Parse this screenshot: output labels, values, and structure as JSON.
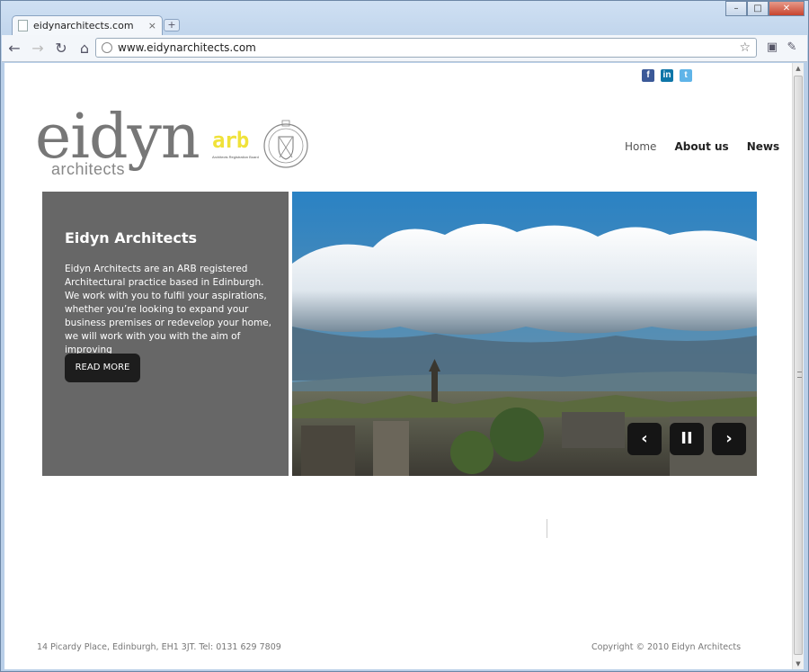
{
  "browser": {
    "tab_title": "eidynarchitects.com",
    "tab_close": "×",
    "new_tab": "+",
    "url": "www.eidynarchitects.com",
    "back_icon": "←",
    "forward_icon": "→",
    "reload_icon": "↻",
    "home_icon": "⌂",
    "star_icon": "☆",
    "page_icon": "▣",
    "wrench_icon": "✎",
    "minimize": "–",
    "maximize": "□",
    "close": "✕"
  },
  "social": {
    "facebook": "f",
    "linkedin": "in",
    "twitter": "t"
  },
  "logo": {
    "word": "eidyn",
    "sub": "architects",
    "arb_mark": "arb",
    "arb_text": "Architects Registration Board"
  },
  "nav": {
    "items": [
      "Home",
      "About us",
      "News"
    ]
  },
  "hero": {
    "title": "Eidyn Architects",
    "text": "Eidyn Architects are an ARB registered Architectural practice based in Edinburgh. We work with you to fulfil your aspirations, whether you’re looking to expand your business premises or redevelop your home, we will work with you with the aim of improving",
    "button": "READ MORE"
  },
  "slider": {
    "prev": "‹",
    "pause": "II",
    "next": "›"
  },
  "footer": {
    "address": "14 Picardy Place, Edinburgh, EH1 3JT. Tel: 0131 629 7809",
    "copyright": "Copyright © 2010 Eidyn Architects"
  },
  "colors": {
    "panel": "#676767",
    "button": "#1d1d1d",
    "arb_yellow": "#f0e23a",
    "sky": "#2b7fbe"
  }
}
